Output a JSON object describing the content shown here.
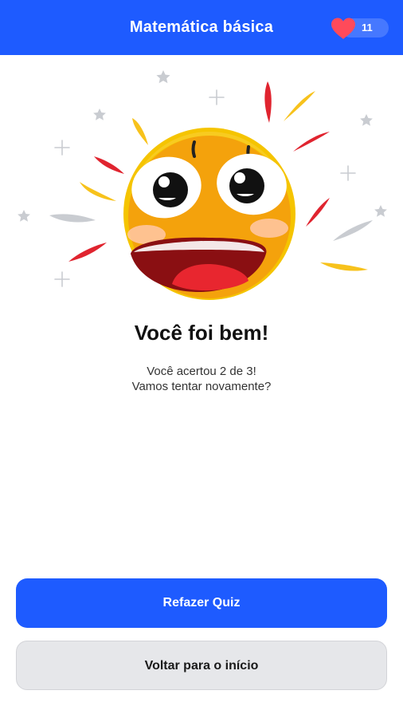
{
  "header": {
    "title": "Matemática básica",
    "lives_count": "11",
    "lives_icon": "heart-icon"
  },
  "result": {
    "title": "Você foi bem!",
    "line1": "Você acertou 2 de 3!",
    "line2": "Vamos tentar novamente?"
  },
  "actions": {
    "retry_label": "Refazer Quiz",
    "home_label": "Voltar para o início"
  },
  "colors": {
    "primary": "#1e5bff",
    "secondary_button": "#e6e7ea",
    "heart": "#ff4a5a"
  }
}
